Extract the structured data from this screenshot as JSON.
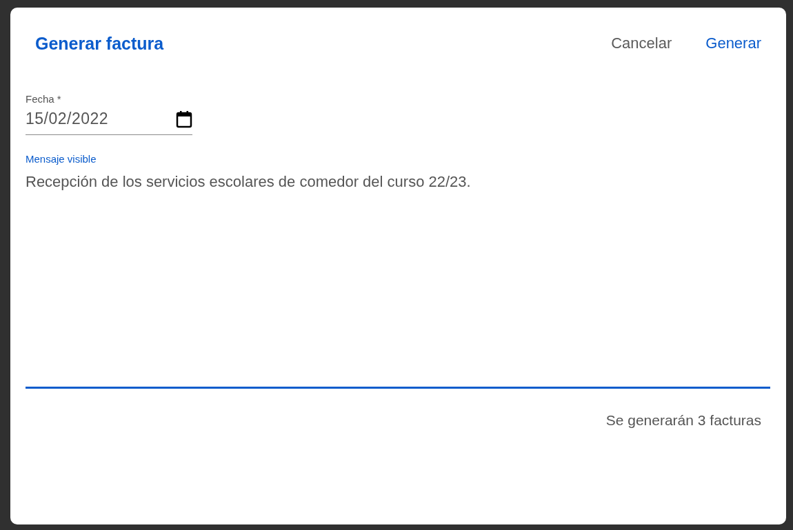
{
  "dialog": {
    "title": "Generar factura",
    "actions": [
      {
        "label": "Cancelar",
        "kind": "secondary"
      },
      {
        "label": "Generar",
        "kind": "primary"
      }
    ],
    "date_field": {
      "label": "Fecha *",
      "value": "15/02/2022"
    },
    "message_field": {
      "label": "Mensaje visible",
      "focused": true,
      "value": "Recepción de los servicios escolares de comedor del curso 22/23."
    },
    "summary": "Se generarán 3 facturas"
  }
}
